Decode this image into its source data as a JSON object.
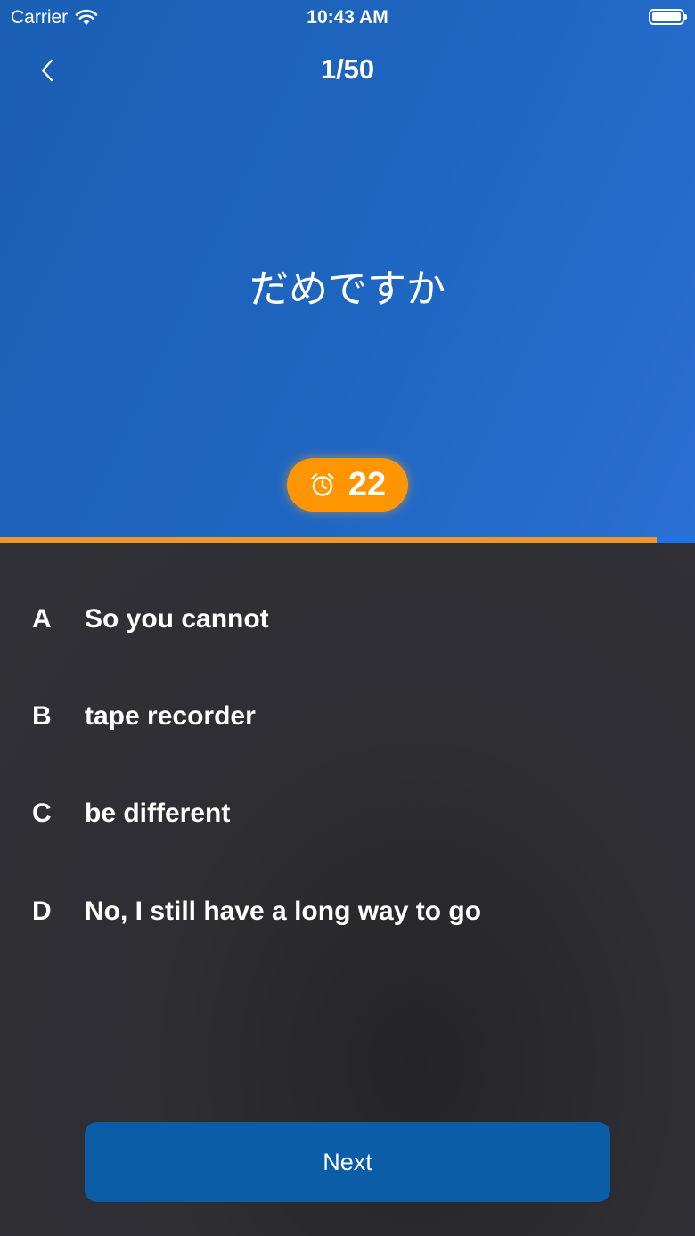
{
  "status_bar": {
    "carrier": "Carrier",
    "time": "10:43 AM",
    "battery_level": 1.0
  },
  "header": {
    "counter": "1/50",
    "back_icon": "chevron-left-icon"
  },
  "question": {
    "text": "だめですか"
  },
  "timer": {
    "icon": "alarm-clock-icon",
    "value": "22"
  },
  "progress": {
    "fraction": 0.945,
    "fill_color": "#f0962a",
    "track_color": "#1e73e8"
  },
  "options": [
    {
      "letter": "A",
      "text": "So you cannot"
    },
    {
      "letter": "B",
      "text": "tape recorder"
    },
    {
      "letter": "C",
      "text": "be different"
    },
    {
      "letter": "D",
      "text": "No, I still have a long way to go"
    }
  ],
  "next_button": {
    "label": "Next"
  },
  "colors": {
    "header_blue": "#1f66c2",
    "timer_orange": "#ff9500",
    "background_dark": "#2e2e33",
    "button_blue": "#0b5da8"
  }
}
